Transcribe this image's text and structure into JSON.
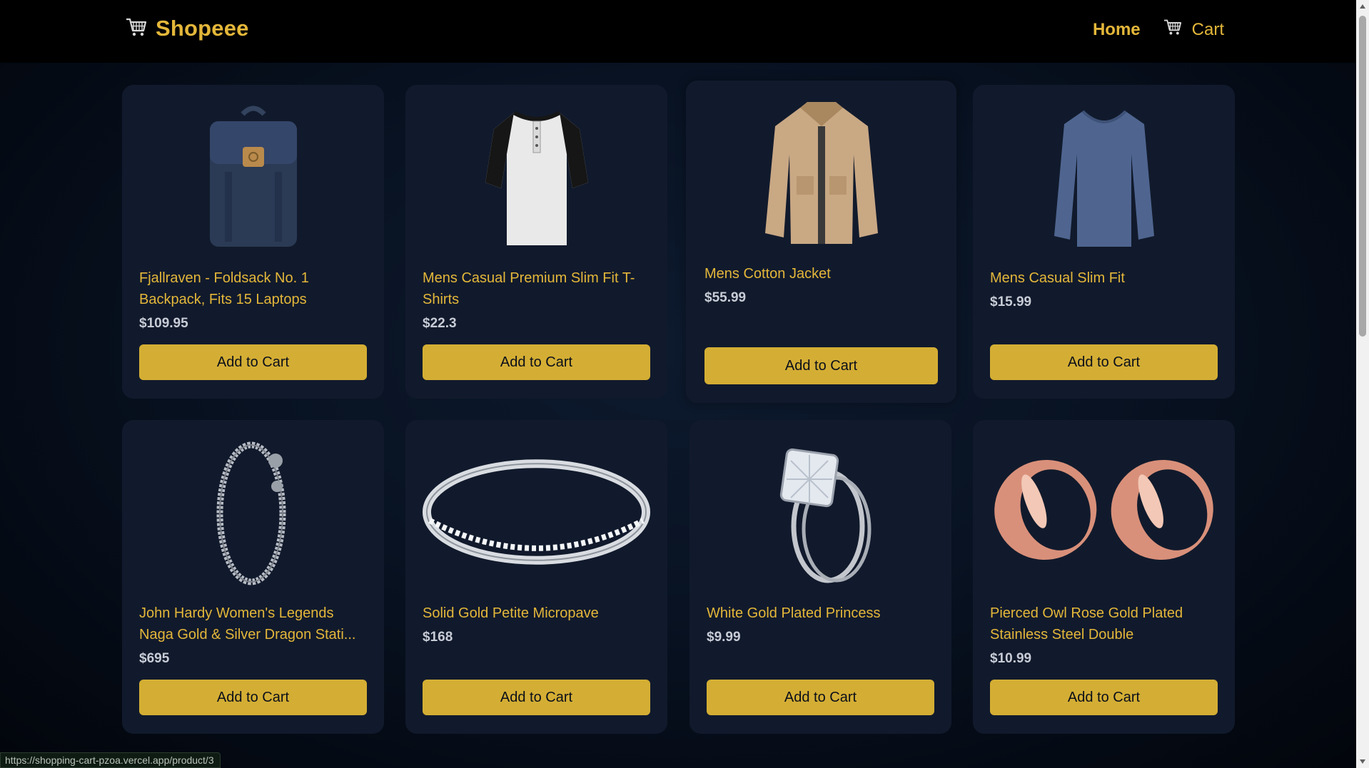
{
  "header": {
    "brand": "Shopeee",
    "brand_icon": "cart-icon",
    "nav": {
      "home": "Home",
      "cart": "Cart"
    }
  },
  "products": [
    {
      "title": "Fjallraven - Foldsack No. 1 Backpack, Fits 15 Laptops",
      "price": "$109.95",
      "button": "Add to Cart",
      "image": "backpack"
    },
    {
      "title": "Mens Casual Premium Slim Fit T-Shirts",
      "price": "$22.3",
      "button": "Add to Cart",
      "image": "tshirt"
    },
    {
      "title": "Mens Cotton Jacket",
      "price": "$55.99",
      "button": "Add to Cart",
      "image": "jacket"
    },
    {
      "title": "Mens Casual Slim Fit",
      "price": "$15.99",
      "button": "Add to Cart",
      "image": "longsleeve"
    },
    {
      "title": "John Hardy Women's Legends Naga Gold & Silver Dragon Stati...",
      "price": "$695",
      "button": "Add to Cart",
      "image": "bracelet"
    },
    {
      "title": "Solid Gold Petite Micropave",
      "price": "$168",
      "button": "Add to Cart",
      "image": "ring-band"
    },
    {
      "title": "White Gold Plated Princess",
      "price": "$9.99",
      "button": "Add to Cart",
      "image": "ring-princess"
    },
    {
      "title": "Pierced Owl Rose Gold Plated Stainless Steel Double",
      "price": "$10.99",
      "button": "Add to Cart",
      "image": "tunnels"
    }
  ],
  "status_url": "https://shopping-cart-pzoa.vercel.app/product/3",
  "colors": {
    "accent": "#e4b73a",
    "button": "#d4ae34",
    "card": "#111a2c",
    "background": "#081222"
  }
}
